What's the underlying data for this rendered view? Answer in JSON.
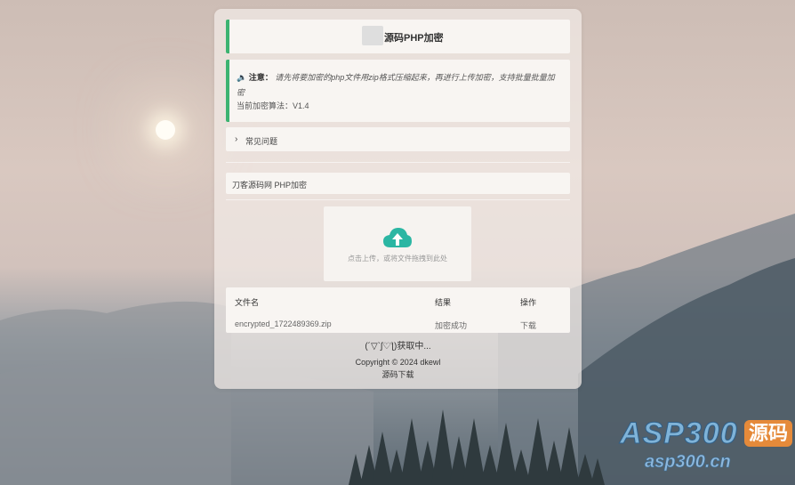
{
  "header": {
    "title": "源码PHP加密"
  },
  "notice": {
    "icon": "speaker-icon",
    "label": "注意：",
    "text": "请先将要加密的php文件用zip格式压缩起来，再进行上传加密，支持批量批量加密",
    "algo_label": "当前加密算法：V1.4"
  },
  "faq": {
    "label": "常见问题",
    "icon": "chevron-right-icon"
  },
  "brand": {
    "label": "刀客源码网 PHP加密"
  },
  "upload": {
    "hint": "点击上传，或将文件拖拽到此处",
    "icon": "cloud-upload-icon",
    "icon_color": "#2bb6a3"
  },
  "table": {
    "headers": [
      "文件名",
      "结果",
      "操作"
    ],
    "rows": [
      {
        "file": "encrypted_1722489369.zip",
        "result": "加密成功",
        "action": "下载"
      }
    ]
  },
  "status": {
    "getting": "(´▽`ʃ♡ƪ)获取中..."
  },
  "footer": {
    "copyright": "Copyright © 2024 dkewl",
    "download": "源码下载"
  },
  "watermark": {
    "text1": "ASP300",
    "text2": "源码",
    "text3": "asp300.cn"
  },
  "colors": {
    "accent": "#3cb371"
  }
}
